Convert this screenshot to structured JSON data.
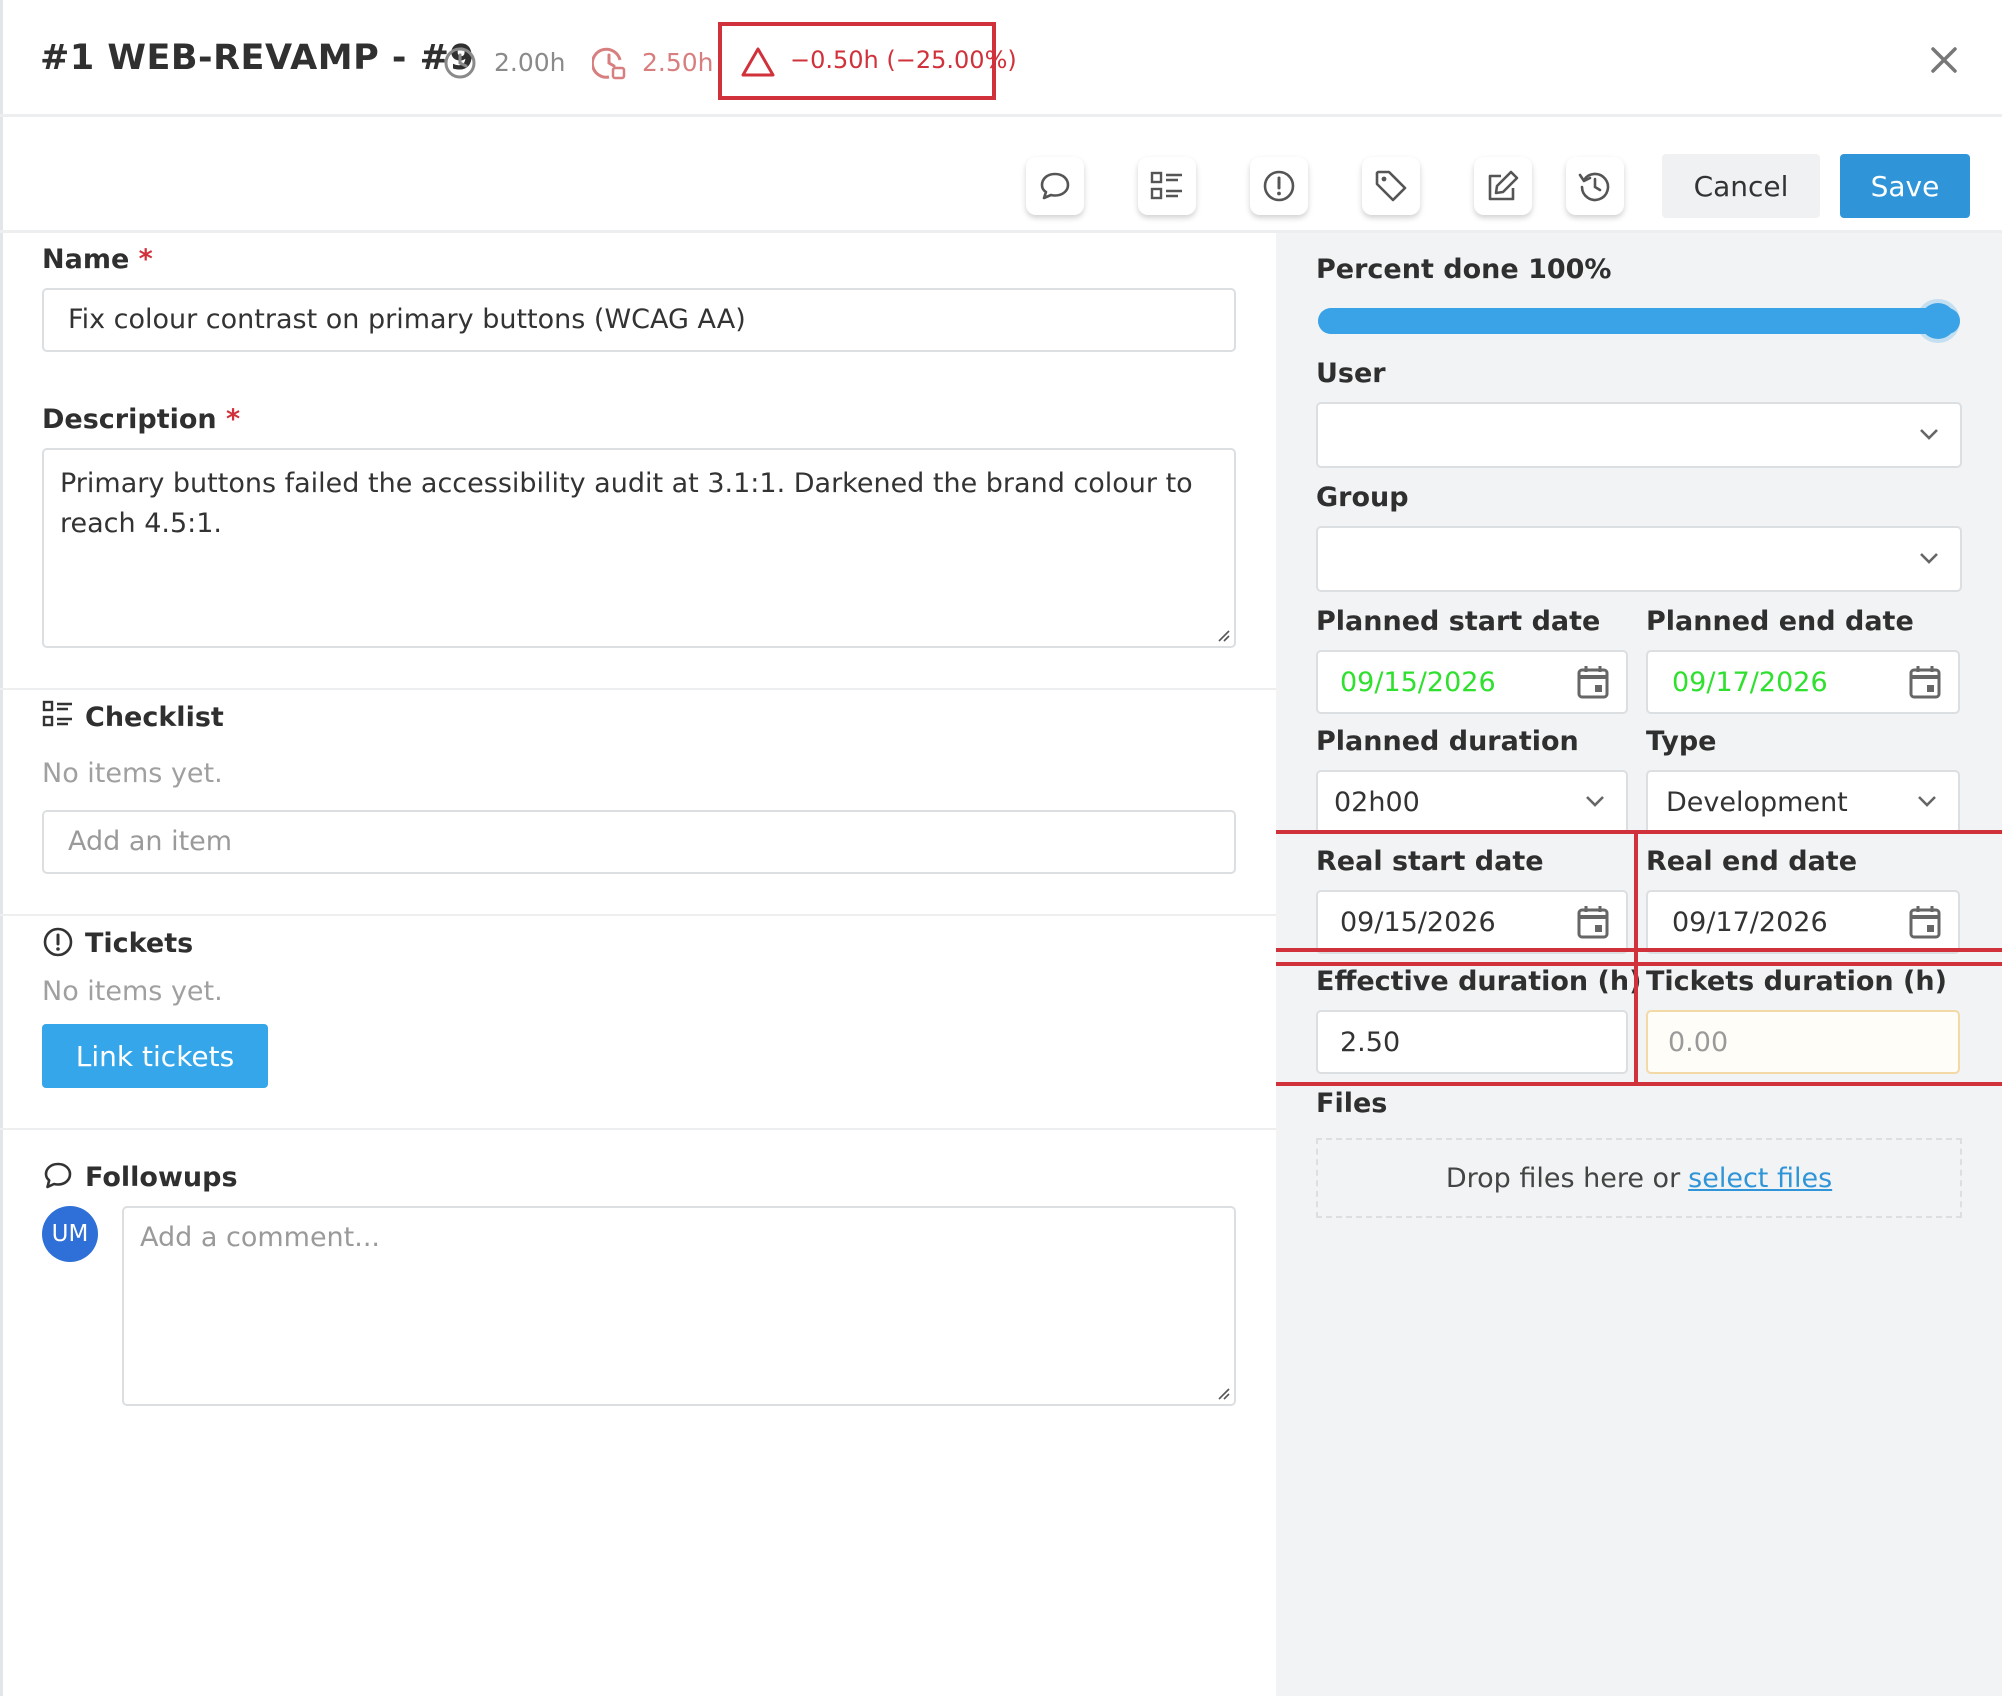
{
  "header": {
    "title": "#1 WEB-REVAMP - #9",
    "planned_hours": "2.00h",
    "effective_hours": "2.50h",
    "difference": "−0.50h (−25.00%)"
  },
  "toolbar": {
    "cancel_label": "Cancel",
    "save_label": "Save"
  },
  "form": {
    "name_label": "Name",
    "name_value": "Fix colour contrast on primary buttons (WCAG AA)",
    "description_label": "Description",
    "description_value": "Primary buttons failed the accessibility audit at 3.1:1. Darkened the brand colour to reach 4.5:1.",
    "required_mark": "*"
  },
  "checklist": {
    "title": "Checklist",
    "empty_text": "No items yet.",
    "add_placeholder": "Add an item"
  },
  "tickets": {
    "title": "Tickets",
    "empty_text": "No items yet.",
    "link_label": "Link tickets"
  },
  "followups": {
    "title": "Followups",
    "avatar_initials": "UM",
    "comment_placeholder": "Add a comment..."
  },
  "side": {
    "percent_label": "Percent done 100%",
    "percent_value": 100,
    "user_label": "User",
    "user_value": "",
    "group_label": "Group",
    "group_value": "",
    "planned_start_label": "Planned start date",
    "planned_start_value": "09/15/2026",
    "planned_end_label": "Planned end date",
    "planned_end_value": "09/17/2026",
    "planned_duration_label": "Planned duration",
    "planned_duration_value": "02h00",
    "type_label": "Type",
    "type_value": "Development",
    "real_start_label": "Real start date",
    "real_start_value": "09/15/2026",
    "real_end_label": "Real end date",
    "real_end_value": "09/17/2026",
    "effective_duration_label": "Effective duration (h)",
    "effective_duration_value": "2.50",
    "tickets_duration_label": "Tickets duration (h)",
    "tickets_duration_value": "0.00",
    "files_label": "Files",
    "drop_text": "Drop files here or",
    "drop_link": "select files"
  },
  "colors": {
    "accent": "#2f95d8",
    "highlight_red": "#d0313a",
    "date_green": "#2fe02f"
  },
  "icons": [
    "clock-icon",
    "clock-lock-icon",
    "warning-triangle-icon",
    "close-icon",
    "comment-icon",
    "checklist-icon",
    "ticket-alert-icon",
    "tag-icon",
    "edit-icon",
    "history-icon",
    "chevron-down-icon",
    "calendar-icon"
  ]
}
